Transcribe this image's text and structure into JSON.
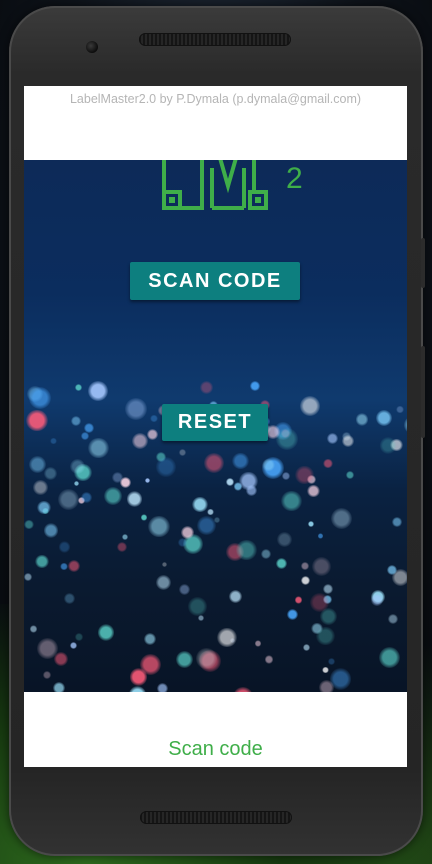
{
  "app": {
    "header_text": "LabelMaster2.0 by P.Dymala (p.dymala@gmail.com)",
    "logo_letters": "LM",
    "logo_version": "2",
    "scan_button_label": "SCAN CODE",
    "reset_button_label": "RESET",
    "footer_link": "Scan code"
  },
  "colors": {
    "accent_teal": "#0d7f7f",
    "brand_green": "#3fae49",
    "header_text": "#b5b5b5"
  },
  "icons": {
    "logo": "labelmaster-lm-logo",
    "device": "android-phone-frame"
  }
}
